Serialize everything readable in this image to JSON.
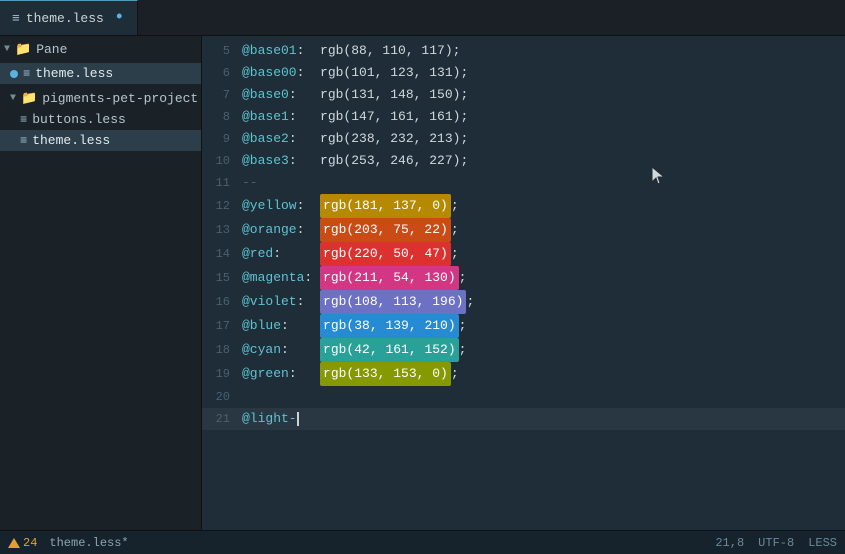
{
  "tab": {
    "icon": "≡",
    "name": "theme.less",
    "modified": true,
    "dot": "•"
  },
  "sidebar": {
    "pane_label": "Pane",
    "active_file": "theme.less",
    "items": [
      {
        "id": "pane",
        "label": "Pane",
        "type": "pane",
        "indent": 0
      },
      {
        "id": "theme-less-top",
        "label": "theme.less",
        "type": "file-active",
        "indent": 0
      },
      {
        "id": "pigments-pet-project",
        "label": "pigments-pet-project",
        "type": "folder",
        "indent": 0
      },
      {
        "id": "buttons-less",
        "label": "buttons.less",
        "type": "file",
        "indent": 1
      },
      {
        "id": "theme-less-bottom",
        "label": "theme.less",
        "type": "file-active-2",
        "indent": 1
      }
    ]
  },
  "editor": {
    "lines": [
      {
        "num": 5,
        "content": "@base01:  rgb(88, 110, 117);",
        "type": "base"
      },
      {
        "num": 6,
        "content": "@base00:  rgb(101, 123, 131);",
        "type": "base"
      },
      {
        "num": 7,
        "content": "@base0:   rgb(131, 148, 150);",
        "type": "base"
      },
      {
        "num": 8,
        "content": "@base1:   rgb(147, 161, 161);",
        "type": "base"
      },
      {
        "num": 9,
        "content": "@base2:   rgb(238, 232, 213);",
        "type": "base"
      },
      {
        "num": 10,
        "content": "@base3:   rgb(253, 246, 227);",
        "type": "base"
      },
      {
        "num": 11,
        "content": "",
        "type": "empty"
      },
      {
        "num": 12,
        "content": "@yellow:  rgb(181, 137, 0);",
        "type": "color",
        "swatch_bg": "#b58900",
        "swatch_text": "#fff",
        "var": "@yellow",
        "val": "rgb(181, 137, 0)"
      },
      {
        "num": 13,
        "content": "@orange:  rgb(203, 75, 22);",
        "type": "color",
        "swatch_bg": "#cb4b16",
        "swatch_text": "#fff",
        "var": "@orange",
        "val": "rgb(203, 75, 22)"
      },
      {
        "num": 14,
        "content": "@red:     rgb(220, 50, 47);",
        "type": "color",
        "swatch_bg": "#dc322f",
        "swatch_text": "#fff",
        "var": "@red",
        "val": "rgb(220, 50, 47)"
      },
      {
        "num": 15,
        "content": "@magenta: rgb(211, 54, 130);",
        "type": "color",
        "swatch_bg": "#d33682",
        "swatch_text": "#fff",
        "var": "@magenta",
        "val": "rgb(211, 54, 130)"
      },
      {
        "num": 16,
        "content": "@violet:  rgb(108, 113, 196);",
        "type": "color",
        "swatch_bg": "#6c71c4",
        "swatch_text": "#fff",
        "var": "@violet",
        "val": "rgb(108, 113, 196)"
      },
      {
        "num": 17,
        "content": "@blue:    rgb(38, 139, 210);",
        "type": "color",
        "swatch_bg": "#268bd2",
        "swatch_text": "#fff",
        "var": "@blue",
        "val": "rgb(38, 139, 210)"
      },
      {
        "num": 18,
        "content": "@cyan:    rgb(42, 161, 152);",
        "type": "color",
        "swatch_bg": "#2aa198",
        "swatch_text": "#fff",
        "var": "@cyan",
        "val": "rgb(42, 161, 152)"
      },
      {
        "num": 19,
        "content": "@green:   rgb(133, 153, 0);",
        "type": "color",
        "swatch_bg": "#859900",
        "swatch_text": "#fff",
        "var": "@green",
        "val": "rgb(133, 153, 0)"
      },
      {
        "num": 20,
        "content": "",
        "type": "empty"
      },
      {
        "num": 21,
        "content": "@light-",
        "type": "cursor",
        "var": "@light-"
      }
    ]
  },
  "status": {
    "icon": "warning",
    "file": "theme.less*",
    "pos": "21,8",
    "warn_count": "24",
    "encoding": "UTF-8",
    "lang": "LESS"
  }
}
